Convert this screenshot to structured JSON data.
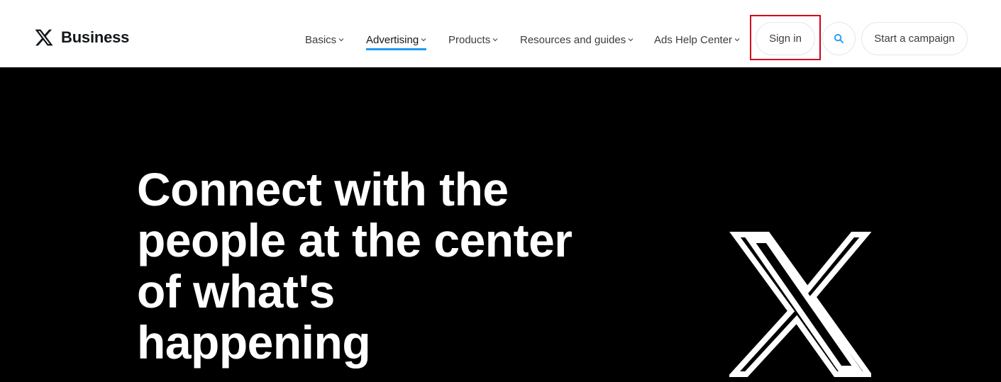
{
  "header": {
    "brand_name": "Business",
    "nav": [
      {
        "label": "Basics",
        "active": false
      },
      {
        "label": "Advertising",
        "active": true
      },
      {
        "label": "Products",
        "active": false
      },
      {
        "label": "Resources and guides",
        "active": false
      },
      {
        "label": "Ads Help Center",
        "active": false
      }
    ],
    "signin_label": "Sign in",
    "campaign_label": "Start a campaign",
    "search_icon": "search-icon",
    "accent_color": "#1d9bf0",
    "highlight_color": "#d0021b"
  },
  "hero": {
    "title": "Connect with the people at the center of what's happening",
    "background_color": "#000000",
    "logo_icon": "x-logo-icon"
  }
}
